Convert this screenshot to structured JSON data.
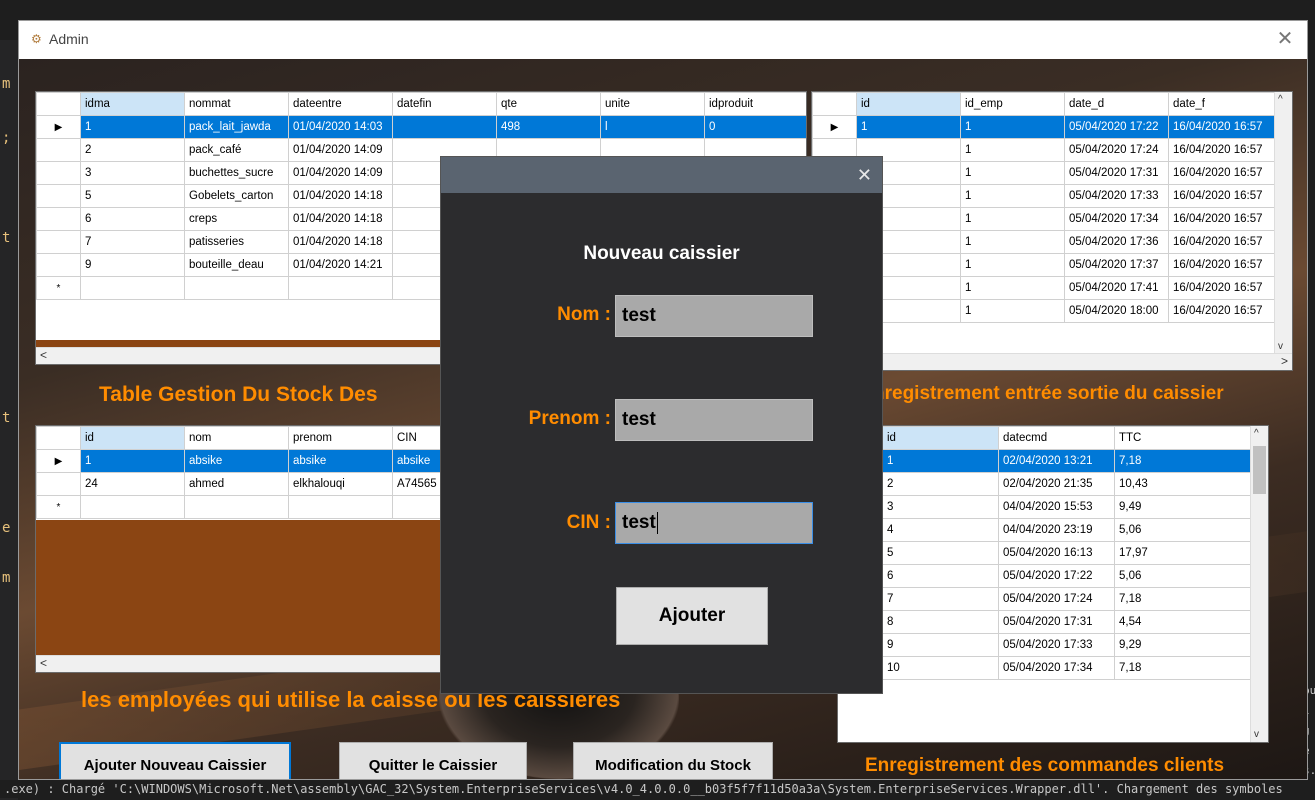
{
  "window": {
    "title": "Admin",
    "app_icon": "gear-icon",
    "close_glyph": "✕"
  },
  "stock_grid": {
    "columns": [
      "idma",
      "nommat",
      "dateentre",
      "datefin",
      "qte",
      "unite",
      "idproduit"
    ],
    "rows": [
      [
        "1",
        "pack_lait_jawda",
        "01/04/2020 14:03",
        "",
        "498",
        "l",
        "0"
      ],
      [
        "2",
        "pack_café",
        "01/04/2020 14:09",
        "",
        "",
        "",
        ""
      ],
      [
        "3",
        "buchettes_sucre",
        "01/04/2020 14:09",
        "",
        "",
        "",
        ""
      ],
      [
        "5",
        "Gobelets_carton",
        "01/04/2020 14:18",
        "",
        "",
        "",
        ""
      ],
      [
        "6",
        "creps",
        "01/04/2020 14:18",
        "",
        "",
        "",
        ""
      ],
      [
        "7",
        "patisseries",
        "01/04/2020 14:18",
        "",
        "",
        "",
        ""
      ],
      [
        "9",
        "bouteille_deau",
        "01/04/2020 14:21",
        "",
        "",
        "",
        ""
      ]
    ],
    "caption": "Table Gestion Du Stock Des"
  },
  "session_grid": {
    "columns": [
      "id",
      "id_emp",
      "date_d",
      "date_f"
    ],
    "rows": [
      [
        "1",
        "1",
        "05/04/2020 17:22",
        "16/04/2020 16:57"
      ],
      [
        "",
        "1",
        "05/04/2020 17:24",
        "16/04/2020 16:57"
      ],
      [
        "",
        "1",
        "05/04/2020 17:31",
        "16/04/2020 16:57"
      ],
      [
        "",
        "1",
        "05/04/2020 17:33",
        "16/04/2020 16:57"
      ],
      [
        "",
        "1",
        "05/04/2020 17:34",
        "16/04/2020 16:57"
      ],
      [
        "",
        "1",
        "05/04/2020 17:36",
        "16/04/2020 16:57"
      ],
      [
        "",
        "1",
        "05/04/2020 17:37",
        "16/04/2020 16:57"
      ],
      [
        "",
        "1",
        "05/04/2020 17:41",
        "16/04/2020 16:57"
      ],
      [
        "",
        "1",
        "05/04/2020 18:00",
        "16/04/2020 16:57"
      ]
    ],
    "caption": "nregistrement entrée sortie du caissier"
  },
  "employee_grid": {
    "columns": [
      "id",
      "nom",
      "prenom",
      "CIN"
    ],
    "rows": [
      [
        "1",
        "absike",
        "absike",
        "absike"
      ],
      [
        "24",
        "ahmed",
        "elkhalouqi",
        "A74565"
      ]
    ],
    "caption": "les employées qui utilise la caisse ou les caissières"
  },
  "orders_grid": {
    "columns": [
      "id",
      "datecmd",
      "TTC"
    ],
    "rows": [
      [
        "1",
        "02/04/2020 13:21",
        "7,18"
      ],
      [
        "2",
        "02/04/2020 21:35",
        "10,43"
      ],
      [
        "3",
        "04/04/2020 15:53",
        "9,49"
      ],
      [
        "4",
        "04/04/2020 23:19",
        "5,06"
      ],
      [
        "5",
        "05/04/2020 16:13",
        "17,97"
      ],
      [
        "6",
        "05/04/2020 17:22",
        "5,06"
      ],
      [
        "7",
        "05/04/2020 17:24",
        "7,18"
      ],
      [
        "8",
        "05/04/2020 17:31",
        "4,54"
      ],
      [
        "9",
        "05/04/2020 17:33",
        "9,29"
      ],
      [
        "10",
        "05/04/2020 17:34",
        "7,18"
      ]
    ],
    "caption": "Enregistrement des commandes clients"
  },
  "buttons": {
    "add_cashier": "Ajouter Nouveau Caissier",
    "quit_cashier": "Quitter  le  Caissier",
    "modify_stock": "Modification du Stock"
  },
  "dialog": {
    "heading": "Nouveau caissier",
    "close_glyph": "✕",
    "nom_label": "Nom :",
    "nom_value": "test",
    "prenom_label": "Prenom :",
    "prenom_value": "test",
    "cin_label": "CIN :",
    "cin_value": "test",
    "submit": "Ajouter"
  },
  "ide": {
    "output_line": ".exe) : Chargé 'C:\\WINDOWS\\Microsoft.Net\\assembly\\GAC_32\\System.EnterpriseServices\\v4.0_4.0.0.0__b03f5f7f11d50a3a\\System.EnterpriseServices.Wrapper.dll'. Chargement des symboles"
  }
}
